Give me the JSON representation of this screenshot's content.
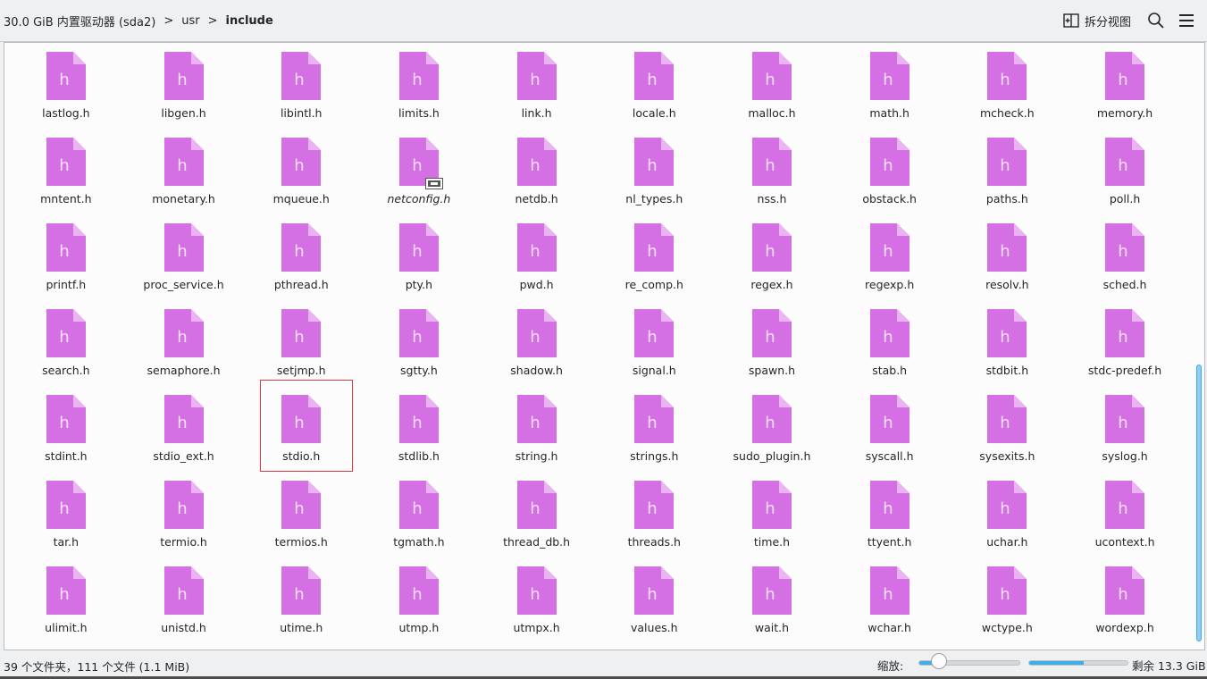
{
  "breadcrumb": {
    "drive": "30.0 GiB 内置驱动器 (sda2)",
    "sep": ">",
    "folder1": "usr",
    "current": "include"
  },
  "toolbar": {
    "split_label": "拆分视图",
    "split_icon": "split-view-icon",
    "search_icon": "search-icon",
    "menu_icon": "hamburger-menu-icon"
  },
  "files": [
    "lastlog.h",
    "libgen.h",
    "libintl.h",
    "limits.h",
    "link.h",
    "locale.h",
    "malloc.h",
    "math.h",
    "mcheck.h",
    "memory.h",
    "mntent.h",
    "monetary.h",
    "mqueue.h",
    "netconfig.h",
    "netdb.h",
    "nl_types.h",
    "nss.h",
    "obstack.h",
    "paths.h",
    "poll.h",
    "printf.h",
    "proc_service.h",
    "pthread.h",
    "pty.h",
    "pwd.h",
    "re_comp.h",
    "regex.h",
    "regexp.h",
    "resolv.h",
    "sched.h",
    "search.h",
    "semaphore.h",
    "setjmp.h",
    "sgtty.h",
    "shadow.h",
    "signal.h",
    "spawn.h",
    "stab.h",
    "stdbit.h",
    "stdc-predef.h",
    "stdint.h",
    "stdio_ext.h",
    "stdio.h",
    "stdlib.h",
    "string.h",
    "strings.h",
    "sudo_plugin.h",
    "syscall.h",
    "sysexits.h",
    "syslog.h",
    "tar.h",
    "termio.h",
    "termios.h",
    "tgmath.h",
    "thread_db.h",
    "threads.h",
    "time.h",
    "ttyent.h",
    "uchar.h",
    "ucontext.h",
    "ulimit.h",
    "unistd.h",
    "utime.h",
    "utmp.h",
    "utmpx.h",
    "values.h",
    "wait.h",
    "wchar.h",
    "wctype.h",
    "wordexp.h"
  ],
  "file_icon_letter": "h",
  "symlink_file": "netconfig.h",
  "highlighted_file": "stdio.h",
  "colors": {
    "icon_fill": "#d46fe4",
    "icon_fold": "#eab3f2",
    "accent": "#3daee9",
    "highlight": "#dc3a3a"
  },
  "status": {
    "summary": "39 个文件夹，111 个文件 (1.1 MiB)",
    "zoom_label": "缩放:",
    "zoom_level": 0.2,
    "free_space": "剩余 13.3 GiB",
    "space_used_fraction": 0.55
  }
}
